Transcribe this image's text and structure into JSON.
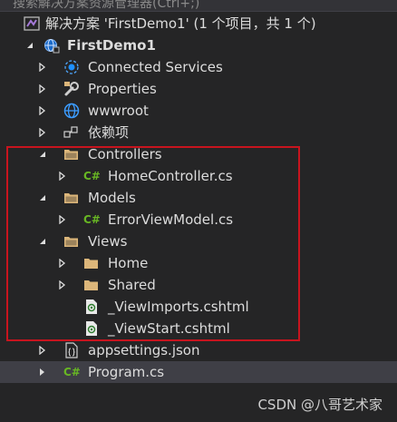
{
  "search": {
    "text": "搜索解决方案资源管理器(Ctrl+;)"
  },
  "solution": {
    "label": "解决方案 'FirstDemo1' (1 个项目，共 1 个)"
  },
  "project": {
    "label": "FirstDemo1"
  },
  "items": {
    "connected_services": "Connected Services",
    "properties": "Properties",
    "wwwroot": "wwwroot",
    "dependencies": "依赖项",
    "controllers": "Controllers",
    "home_controller": "HomeController.cs",
    "models": "Models",
    "error_view_model": "ErrorViewModel.cs",
    "views": "Views",
    "home": "Home",
    "shared": "Shared",
    "view_imports": "_ViewImports.cshtml",
    "view_start": "_ViewStart.cshtml",
    "appsettings": "appsettings.json",
    "program": "Program.cs"
  },
  "csharp_icon_text": "C#",
  "watermark": "CSDN @八哥艺术家",
  "colors": {
    "background": "#252526",
    "selected_row": "#3f3f46",
    "highlight_border": "#c8141e",
    "folder": "#dcb67a",
    "csharp": "#68b723"
  }
}
